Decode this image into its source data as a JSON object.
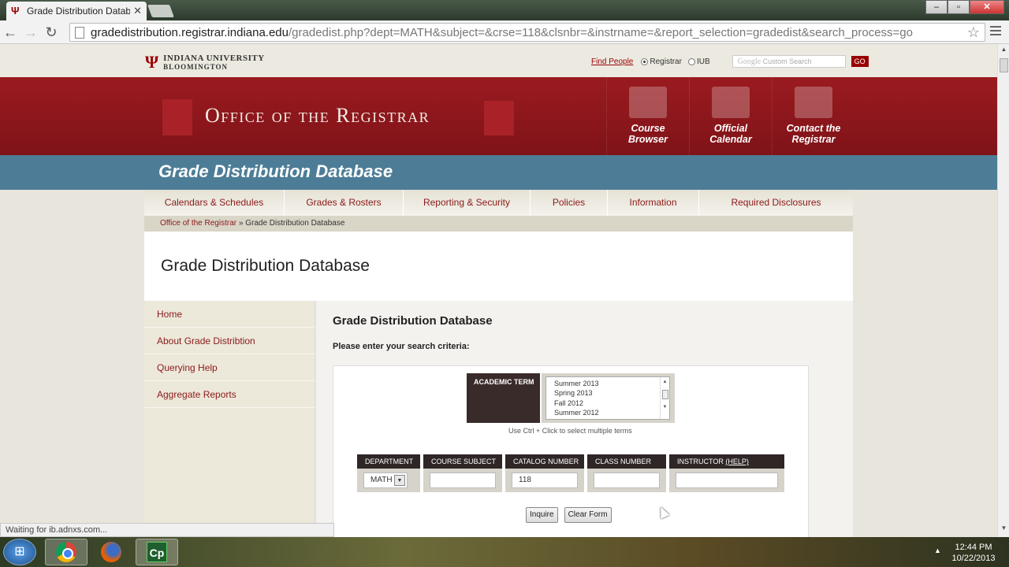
{
  "browser": {
    "tab_title": "Grade Distribution Databa",
    "url_host": "gradedistribution.registrar.indiana.edu",
    "url_path": "/gradedist.php?dept=MATH&subject=&crse=118&clsnbr=&instrname=&report_selection=gradedist&search_process=go",
    "status_text": "Waiting for ib.adnxs.com..."
  },
  "topbar": {
    "university": "INDIANA UNIVERSITY",
    "campus": "BLOOMINGTON",
    "find_people": "Find People",
    "radio_registrar": "Registrar",
    "radio_iub": "IUB",
    "search_brand": "Google",
    "search_placeholder": "Custom Search",
    "go_label": "GO"
  },
  "banner": {
    "title": "Office of the Registrar",
    "links": [
      {
        "line1": "Course",
        "line2": "Browser"
      },
      {
        "line1": "Official",
        "line2": "Calendar"
      },
      {
        "line1": "Contact the",
        "line2": "Registrar"
      }
    ]
  },
  "bluebar": {
    "title": "Grade Distribution Database"
  },
  "nav": {
    "items": [
      "Calendars & Schedules",
      "Grades & Rosters",
      "Reporting & Security",
      "Policies",
      "Information",
      "Required Disclosures"
    ]
  },
  "breadcrumb": {
    "home": "Office of the Registrar",
    "sep": " » ",
    "current": "Grade Distribution Database"
  },
  "page_title": "Grade Distribution Database",
  "sidebar": {
    "items": [
      "Home",
      "About Grade Distribtion",
      "Querying Help",
      "Aggregate Reports"
    ]
  },
  "main": {
    "heading": "Grade Distribution Database",
    "criteria_label": "Please enter your search criteria:",
    "term_label": "ACADEMIC TERM",
    "terms": [
      "Summer 2013",
      "Spring 2013",
      "Fall 2012",
      "Summer 2012"
    ],
    "term_hint": "Use Ctrl + Click to select multiple terms",
    "fields": {
      "department": {
        "label": "DEPARTMENT",
        "value": "MATH"
      },
      "course_subject": {
        "label": "COURSE SUBJECT",
        "value": ""
      },
      "catalog_number": {
        "label": "CATALOG NUMBER",
        "value": "118"
      },
      "class_number": {
        "label": "CLASS NUMBER",
        "value": ""
      },
      "instructor": {
        "label": "INSTRUCTOR",
        "help": "(HELP)",
        "value": ""
      }
    },
    "inquire_label": "Inquire",
    "clear_label": "Clear Form"
  },
  "taskbar": {
    "time": "12:44 PM",
    "date": "10/22/2013",
    "cp_label": "Cp"
  },
  "colors": {
    "brand_crimson": "#990000",
    "banner": "#8a1a1f",
    "blue_bar": "#4d7d96",
    "header_dark": "#2f2626"
  }
}
